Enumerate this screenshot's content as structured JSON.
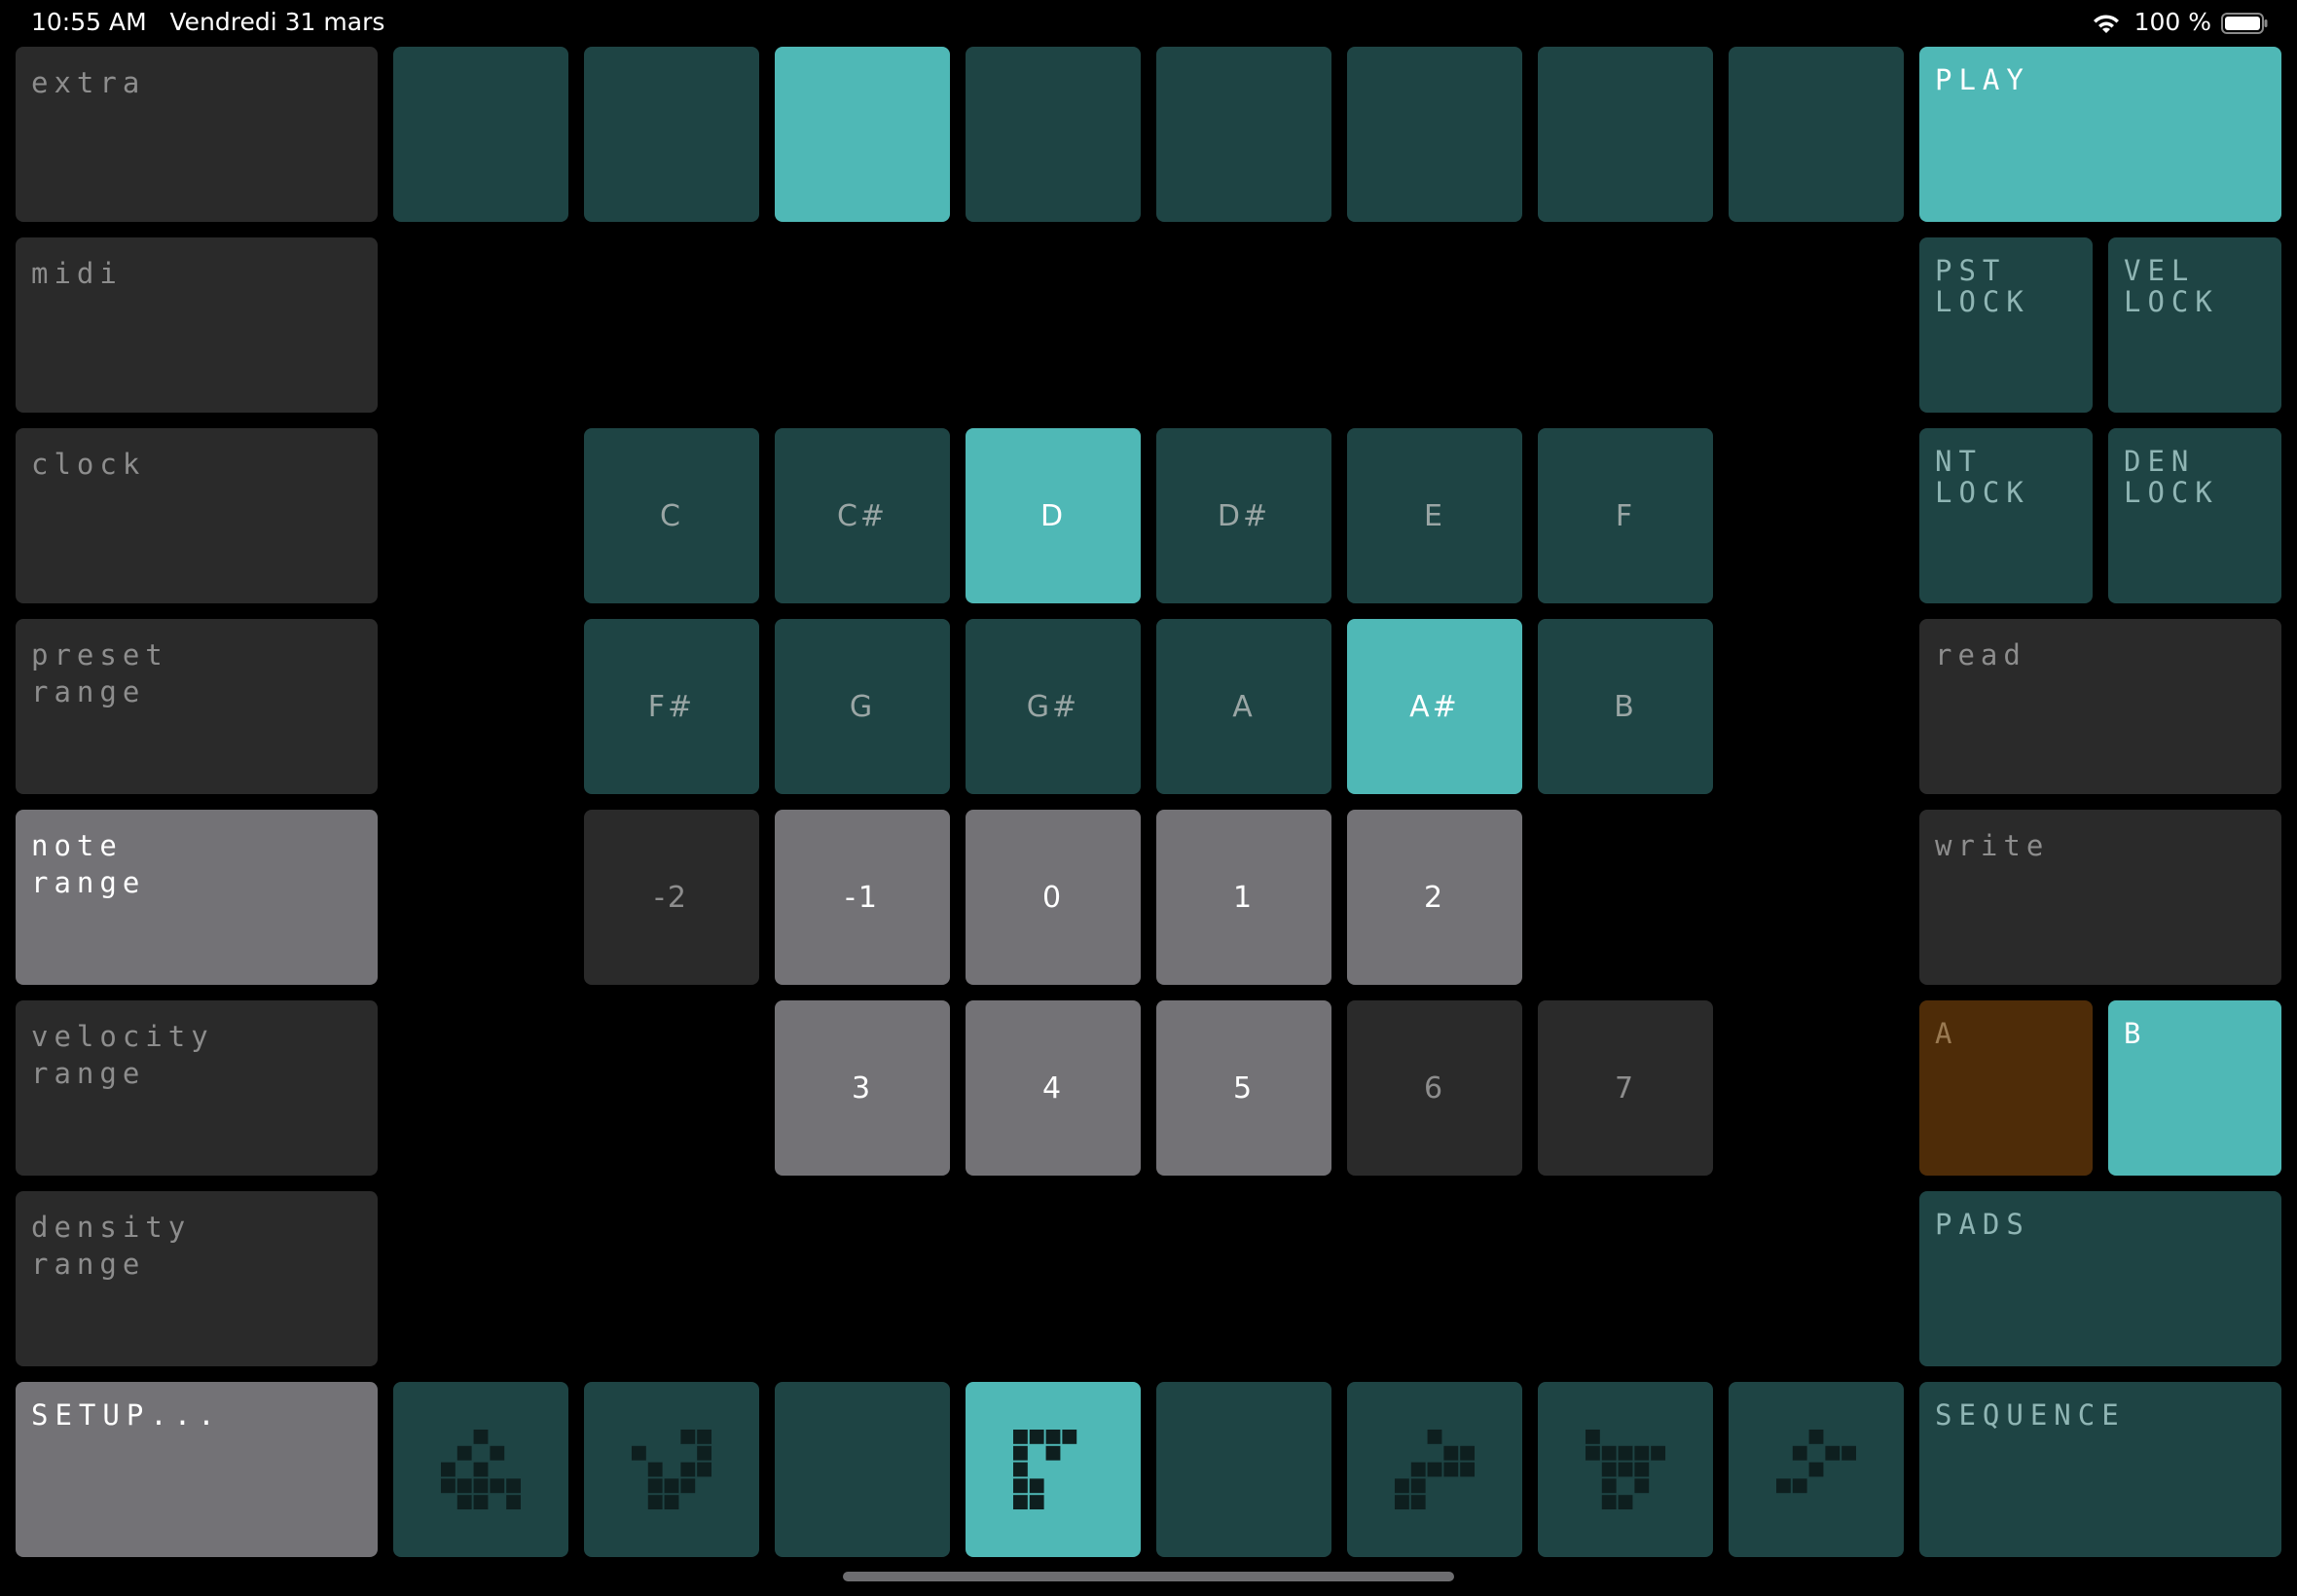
{
  "status_bar": {
    "time": "10:55 AM",
    "date": "Vendredi 31 mars",
    "battery": "100 %"
  },
  "left_menu": [
    {
      "label": "extra",
      "active": false
    },
    {
      "label": "midi",
      "active": false
    },
    {
      "label": "clock",
      "active": false
    },
    {
      "label": "preset\nrange",
      "active": false
    },
    {
      "label": "note\nrange",
      "active": true
    },
    {
      "label": "velocity\nrange",
      "active": false
    },
    {
      "label": "density\nrange",
      "active": false
    },
    {
      "label": "SETUP...",
      "active": true
    }
  ],
  "top_steps": {
    "count": 8,
    "active_index": 2
  },
  "play_button": {
    "label": "PLAY",
    "active": true
  },
  "locks": {
    "pst": "PST\nLOCK",
    "vel": "VEL\nLOCK",
    "nt": "NT\nLOCK",
    "den": "DEN\nLOCK"
  },
  "notes": {
    "row1": [
      "C",
      "C#",
      "D",
      "D#",
      "E",
      "F"
    ],
    "row2": [
      "F#",
      "G",
      "G#",
      "A",
      "A#",
      "B"
    ],
    "active": [
      "D",
      "A#"
    ]
  },
  "octaves": {
    "row1": [
      {
        "label": "-2",
        "active": false
      },
      {
        "label": "-1",
        "active": true
      },
      {
        "label": "0",
        "active": true
      },
      {
        "label": "1",
        "active": true
      },
      {
        "label": "2",
        "active": true
      }
    ],
    "row2": [
      {
        "label": "3",
        "active": true
      },
      {
        "label": "4",
        "active": true
      },
      {
        "label": "5",
        "active": true
      },
      {
        "label": "6",
        "active": false
      },
      {
        "label": "7",
        "active": false
      }
    ]
  },
  "read_button": {
    "label": "read"
  },
  "write_button": {
    "label": "write"
  },
  "ab": {
    "a": "A",
    "b": "B",
    "active": "B"
  },
  "pads_button": {
    "label": "PADS"
  },
  "sequence_button": {
    "label": "SEQUENCE"
  },
  "bottom_patterns": {
    "count": 8,
    "active_index": 3,
    "icons": [
      "pattern-1-icon",
      "pattern-2-icon",
      "pattern-3-icon",
      "pattern-4-icon",
      "pattern-5-icon",
      "pattern-6-icon",
      "pattern-7-icon",
      "pattern-8-icon"
    ]
  },
  "colors": {
    "teal": "#1e4444",
    "teal_active": "#4fb8b6",
    "grey": "#2a2a2a",
    "grey_active": "#737276",
    "brown": "#4e2c08"
  }
}
